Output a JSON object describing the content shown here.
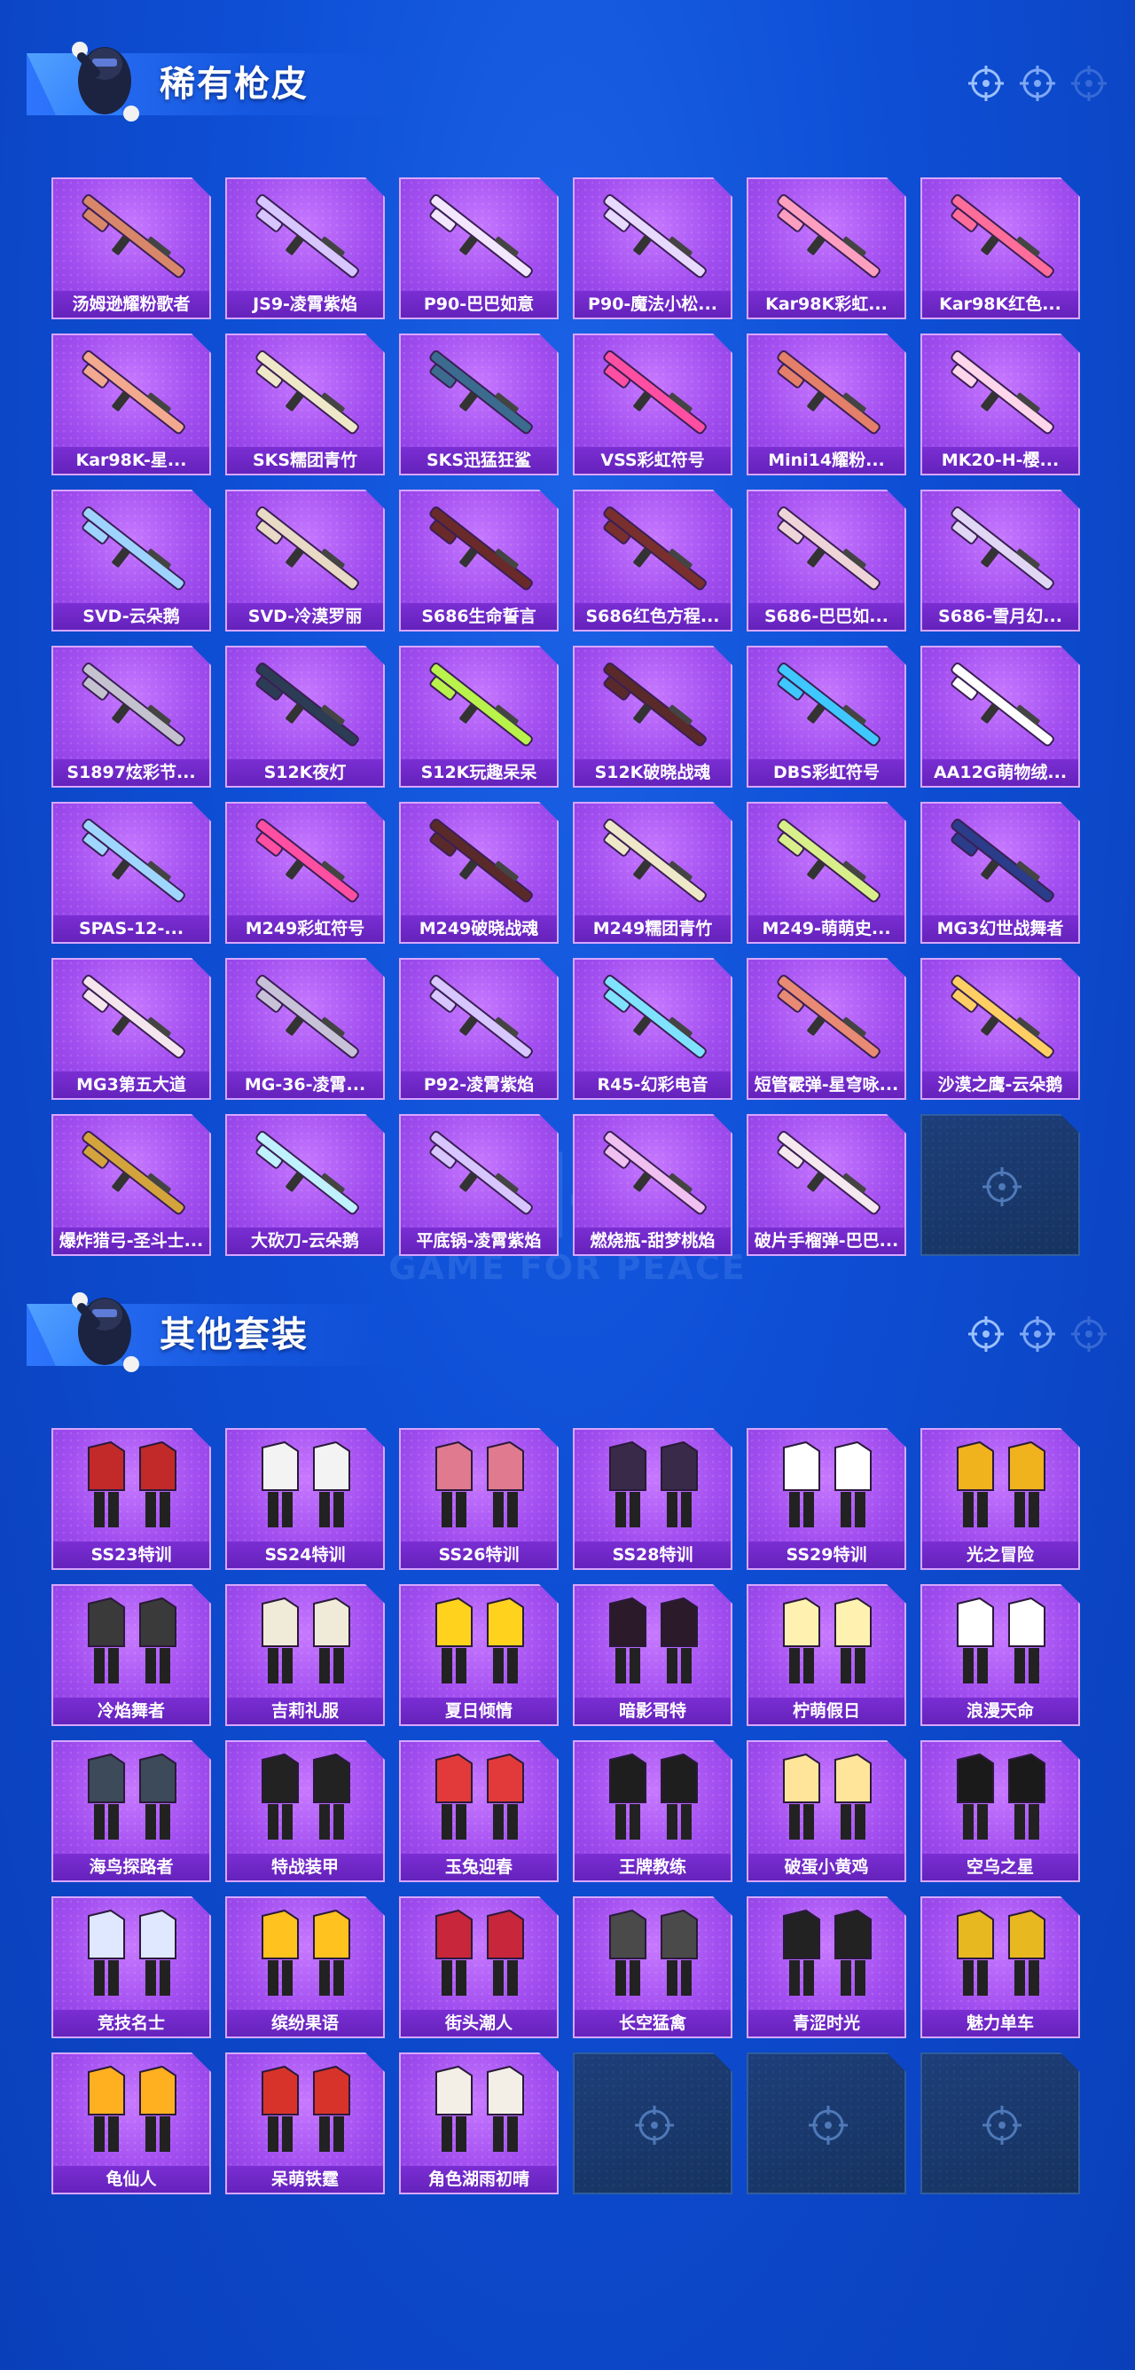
{
  "watermark": {
    "big": "和平",
    "small": "GAME FOR PEACE"
  },
  "sections": [
    {
      "title": "稀有枪皮",
      "items": [
        {
          "label": "汤姆逊耀粉歌者",
          "color": "#d8876a"
        },
        {
          "label": "JS9-凌霄紫焰",
          "color": "#d7c6ff"
        },
        {
          "label": "P90-巴巴如意",
          "color": "#f3e6ff"
        },
        {
          "label": "P90-魔法小松...",
          "color": "#e8d9ff"
        },
        {
          "label": "Kar98K彩虹...",
          "color": "#ff9fc0"
        },
        {
          "label": "Kar98K红色...",
          "color": "#ff6d9a"
        },
        {
          "label": "Kar98K-星...",
          "color": "#f2a98f"
        },
        {
          "label": "SKS糯团青竹",
          "color": "#efe8c8"
        },
        {
          "label": "SKS迅猛狂鲨",
          "color": "#3b6c8f"
        },
        {
          "label": "VSS彩虹符号",
          "color": "#ff4fa3"
        },
        {
          "label": "Mini14耀粉...",
          "color": "#e47f6a"
        },
        {
          "label": "MK20-H-樱...",
          "color": "#ffd6ea"
        },
        {
          "label": "SVD-云朵鹅",
          "color": "#9fd3ff"
        },
        {
          "label": "SVD-冷漠罗丽",
          "color": "#e8dac5"
        },
        {
          "label": "S686生命誓言",
          "color": "#6a2a2a"
        },
        {
          "label": "S686红色方程...",
          "color": "#7a2f2f"
        },
        {
          "label": "S686-巴巴如...",
          "color": "#f0d5d8"
        },
        {
          "label": "S686-雪月幻...",
          "color": "#e1d7f5"
        },
        {
          "label": "S1897炫彩节...",
          "color": "#c4c2ce"
        },
        {
          "label": "S12K夜灯",
          "color": "#2c3c55"
        },
        {
          "label": "S12K玩趣呆呆",
          "color": "#b8f24a"
        },
        {
          "label": "S12K破晓战魂",
          "color": "#5a2a2a"
        },
        {
          "label": "DBS彩虹符号",
          "color": "#3ec8ff"
        },
        {
          "label": "AA12G萌物绒...",
          "color": "#ffffff"
        },
        {
          "label": "SPAS-12-...",
          "color": "#9fd6ff"
        },
        {
          "label": "M249彩虹符号",
          "color": "#ff4fa3"
        },
        {
          "label": "M249破晓战魂",
          "color": "#5a2a2a"
        },
        {
          "label": "M249糯团青竹",
          "color": "#efe8c8"
        },
        {
          "label": "M249-萌萌史...",
          "color": "#d9f08a"
        },
        {
          "label": "MG3幻世战舞者",
          "color": "#2a3c8a"
        },
        {
          "label": "MG3第五大道",
          "color": "#f5e6ee"
        },
        {
          "label": "MG-36-凌霄...",
          "color": "#c8c2d8"
        },
        {
          "label": "P92-凌霄紫焰",
          "color": "#d7c6ff"
        },
        {
          "label": "R45-幻彩电音",
          "color": "#7fe3ff"
        },
        {
          "label": "短管霰弹-星穹咏...",
          "color": "#e88a74"
        },
        {
          "label": "沙漠之鹰-云朵鹅",
          "color": "#ffcf63"
        },
        {
          "label": "爆炸猎弓-圣斗士...",
          "color": "#d4a43c"
        },
        {
          "label": "大砍刀-云朵鹅",
          "color": "#bff1ff"
        },
        {
          "label": "平底锅-凌霄紫焰",
          "color": "#d7c6ff"
        },
        {
          "label": "燃烧瓶-甜梦桃焰",
          "color": "#f0c0f0"
        },
        {
          "label": "破片手榴弹-巴巴...",
          "color": "#f5e8ee"
        },
        {
          "empty": true
        }
      ]
    },
    {
      "title": "其他套装",
      "items": [
        {
          "label": "SS23特训",
          "color": "#c22a2a"
        },
        {
          "label": "SS24特训",
          "color": "#f3f3f3"
        },
        {
          "label": "SS26特训",
          "color": "#e07a8e"
        },
        {
          "label": "SS28特训",
          "color": "#3a2a4a"
        },
        {
          "label": "SS29特训",
          "color": "#ffffff"
        },
        {
          "label": "光之冒险",
          "color": "#f0b21d"
        },
        {
          "label": "冷焰舞者",
          "color": "#3a3a3a"
        },
        {
          "label": "吉莉礼服",
          "color": "#f0ead8"
        },
        {
          "label": "夏日倾情",
          "color": "#ffd21e"
        },
        {
          "label": "暗影哥特",
          "color": "#2a1a2a"
        },
        {
          "label": "柠萌假日",
          "color": "#fff2b0"
        },
        {
          "label": "浪漫天命",
          "color": "#ffffff"
        },
        {
          "label": "海鸟探路者",
          "color": "#3c4a5a"
        },
        {
          "label": "特战装甲",
          "color": "#222222"
        },
        {
          "label": "玉兔迎春",
          "color": "#e23a3a"
        },
        {
          "label": "王牌教练",
          "color": "#1e1e1e"
        },
        {
          "label": "破蛋小黄鸡",
          "color": "#ffe59a"
        },
        {
          "label": "空乌之星",
          "color": "#1a1a1a"
        },
        {
          "label": "竞技名士",
          "color": "#dfe8ff"
        },
        {
          "label": "缤纷果语",
          "color": "#ffc21e"
        },
        {
          "label": "街头潮人",
          "color": "#c8263a"
        },
        {
          "label": "长空猛禽",
          "color": "#4a4a4a"
        },
        {
          "label": "青涩时光",
          "color": "#222222"
        },
        {
          "label": "魅力单车",
          "color": "#e7b820"
        },
        {
          "label": "龟仙人",
          "color": "#ffb020"
        },
        {
          "label": "呆萌铁霆",
          "color": "#d8332a"
        },
        {
          "label": "角色湖雨初晴",
          "color": "#f3efe6"
        },
        {
          "empty": true
        },
        {
          "empty": true
        },
        {
          "empty": true
        }
      ]
    }
  ]
}
